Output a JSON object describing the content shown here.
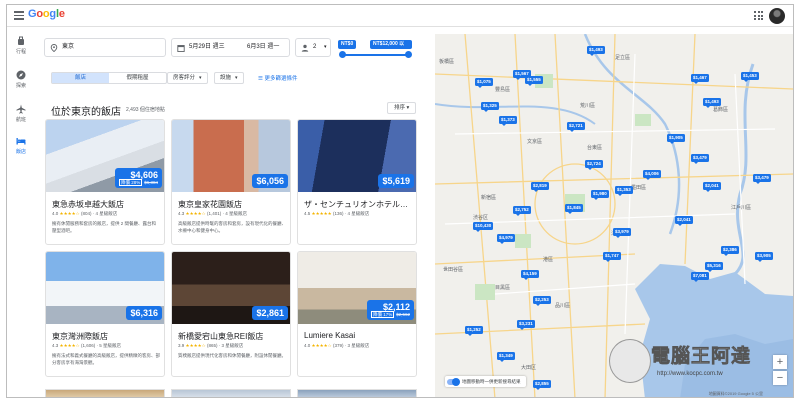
{
  "header": {
    "logo": "Google",
    "logo_colors": [
      "#4285F4",
      "#EA4335",
      "#FBBC05",
      "#4285F4",
      "#34A853",
      "#EA4335"
    ]
  },
  "rail": [
    {
      "label": "行程",
      "icon": "luggage-icon"
    },
    {
      "label": "探索",
      "icon": "compass-icon"
    },
    {
      "label": "航班",
      "icon": "flight-icon"
    },
    {
      "label": "飯店",
      "icon": "hotel-icon",
      "active": true
    }
  ],
  "search": {
    "location": "東京",
    "checkin": "5月29日 週三",
    "checkout": "6月3日 週一",
    "guests": "2",
    "price_min": "NT$0",
    "price_max": "NT$12,000 以上"
  },
  "tabs": [
    {
      "label": "飯店",
      "active": true
    },
    {
      "label": "假期租屋",
      "active": false
    }
  ],
  "filters": {
    "guest_rating": "房客評分",
    "amenities": "設施",
    "more": "更多篩選條件"
  },
  "list": {
    "title": "位於東京的飯店",
    "count": "2,493 個住宿地點",
    "sort": "排序"
  },
  "hotels": [
    {
      "name": "東急赤坂卓越大飯店",
      "price": "$4,606",
      "discount": "降價 28%",
      "old_price": "$6,384",
      "rating": "4.0",
      "stars": "★★★★☆",
      "reviews": "(804)",
      "class": "4 星級飯店",
      "desc": "擁有休閒服務和套房的飯店，提供 2 間餐廳、露台和壓型酒吧。"
    },
    {
      "name": "東京皇家花園飯店",
      "price": "$6,056",
      "discount": "",
      "old_price": "",
      "rating": "4.3",
      "stars": "★★★★☆",
      "reviews": "(1,401)",
      "class": "4 星級飯店",
      "desc": "高級飯店提供時髦的客房和套房，設有現代化的餐廳、水療中心和健身中心。"
    },
    {
      "name": "ザ・センチュリオンホテル…",
      "price": "$5,619",
      "discount": "",
      "old_price": "",
      "rating": "4.5",
      "stars": "★★★★★",
      "reviews": "(136)",
      "class": "4 星級飯店",
      "desc": ""
    },
    {
      "name": "東京灣洲際飯店",
      "price": "$6,316",
      "discount": "",
      "old_price": "",
      "rating": "4.3",
      "stars": "★★★★☆",
      "reviews": "(1,606)",
      "class": "5 星級飯店",
      "desc": "擁有法式和義式餐廳的高級飯店，提供精緻的客房、部分客房享有海灣景觀。"
    },
    {
      "name": "新橋愛宕山東急REI飯店",
      "price": "$2,861",
      "discount": "",
      "old_price": "",
      "rating": "3.9",
      "stars": "★★★★☆",
      "reviews": "(865)",
      "class": "3 星級飯店",
      "desc": "質樸飯店提供現代化客房和休閒餐廳，附設休閒餐廳。"
    },
    {
      "name": "Lumiere Kasai",
      "price": "$2,112",
      "discount": "降價 17%",
      "old_price": "$2,562",
      "rating": "4.0",
      "stars": "★★★★☆",
      "reviews": "(379)",
      "class": "3 星級飯店",
      "desc": ""
    }
  ],
  "map": {
    "toggle": "地圖移動時一併更新搜尋結果",
    "zoom_in": "+",
    "zoom_out": "−",
    "footer": "地圖資料©2019 Google  5 公里",
    "places": [
      "板橋區",
      "豐島區",
      "荒川區",
      "足立區",
      "葛飾區",
      "文京區",
      "台東區",
      "墨田區",
      "江戶川區",
      "新宿區",
      "渋谷区",
      "港區",
      "江東區",
      "目黑區",
      "大田区",
      "品川區",
      "世田谷區"
    ],
    "pins": [
      "$1,493",
      "$1,567",
      "$1,467",
      "$1,075",
      "$1,555",
      "$1,453",
      "$1,493",
      "$1,325",
      "$1,373",
      "$2,721",
      "$1,905",
      "$2,041",
      "$2,724",
      "$2,819",
      "$1,980",
      "$1,353",
      "$3,479",
      "$4,006",
      "$1,845",
      "$2,752",
      "$2,041",
      "$3,979",
      "$10,430",
      "$4,979",
      "$1,747",
      "$2,386",
      "$5,316",
      "$4,159",
      "$2,253",
      "$3,905",
      "$1,252",
      "$3,231",
      "$7,081",
      "$2,855",
      "$1,349",
      "$3,479"
    ]
  },
  "watermark": {
    "brand": "電腦王阿達",
    "url": "http://www.kocpc.com.tw"
  }
}
